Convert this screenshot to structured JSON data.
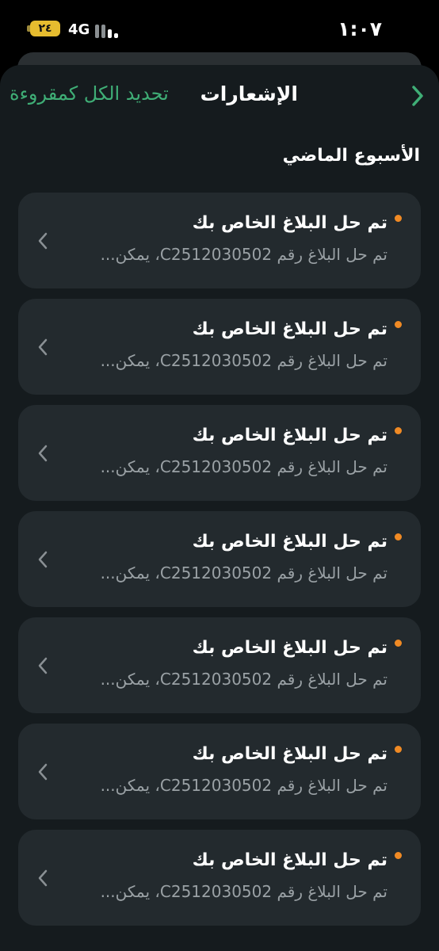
{
  "status_bar": {
    "time": "١:٠٧",
    "battery": "٢٤",
    "network": "4G"
  },
  "header": {
    "title": "الإشعارات",
    "mark_all_read": "تحديد الكل كمقروءة"
  },
  "section": {
    "title": "الأسبوع الماضي"
  },
  "colors": {
    "accent_green": "#3fae76",
    "unread_dot": "#f08a24",
    "card_bg": "#232a2e",
    "sheet_bg": "#151b1e"
  },
  "icons": {
    "back": "chevron-right-icon",
    "card": "chevron-left-icon"
  },
  "notifications": [
    {
      "title": "تم حل البلاغ الخاص بك",
      "body": "تم حل البلاغ رقم C2512030502، يمكن...",
      "unread": true
    },
    {
      "title": "تم حل البلاغ الخاص بك",
      "body": "تم حل البلاغ رقم C2512030502، يمكن...",
      "unread": true
    },
    {
      "title": "تم حل البلاغ الخاص بك",
      "body": "تم حل البلاغ رقم C2512030502، يمكن...",
      "unread": true
    },
    {
      "title": "تم حل البلاغ الخاص بك",
      "body": "تم حل البلاغ رقم C2512030502، يمكن...",
      "unread": true
    },
    {
      "title": "تم حل البلاغ الخاص بك",
      "body": "تم حل البلاغ رقم C2512030502، يمكن...",
      "unread": true
    },
    {
      "title": "تم حل البلاغ الخاص بك",
      "body": "تم حل البلاغ رقم C2512030502، يمكن...",
      "unread": true
    },
    {
      "title": "تم حل البلاغ الخاص بك",
      "body": "تم حل البلاغ رقم C2512030502، يمكن...",
      "unread": true
    }
  ]
}
